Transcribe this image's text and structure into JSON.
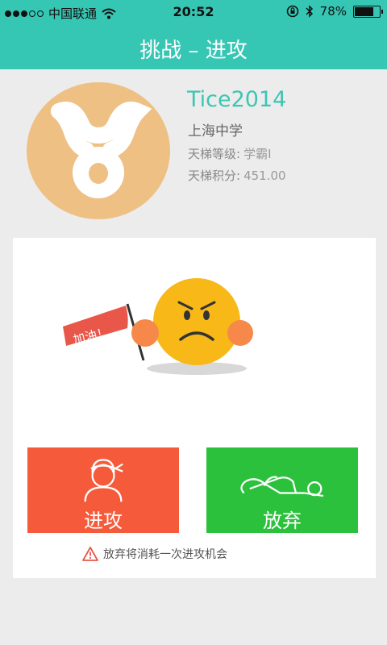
{
  "status_bar": {
    "carrier": "中国联通",
    "time": "20:52",
    "battery": "78%",
    "battery_level": 0.78,
    "signal_bars_filled": 3,
    "signal_bars_total": 5
  },
  "header": {
    "title": "挑战 – 进攻"
  },
  "profile": {
    "username": "Tice2014",
    "school": "上海中学",
    "rank_label": "天梯等级:",
    "rank_value": "学霸I",
    "score_label": "天梯积分:",
    "score_value": "451.00"
  },
  "challenge": {
    "flag_text": "加油！",
    "attack_label": "进攻",
    "giveup_label": "放弃",
    "warning_text": "放弃将消耗一次进攻机会"
  },
  "colors": {
    "accent": "#36c6b4",
    "attack": "#f55b3b",
    "giveup": "#2cc13c",
    "avatar_bg": "#eec084"
  }
}
